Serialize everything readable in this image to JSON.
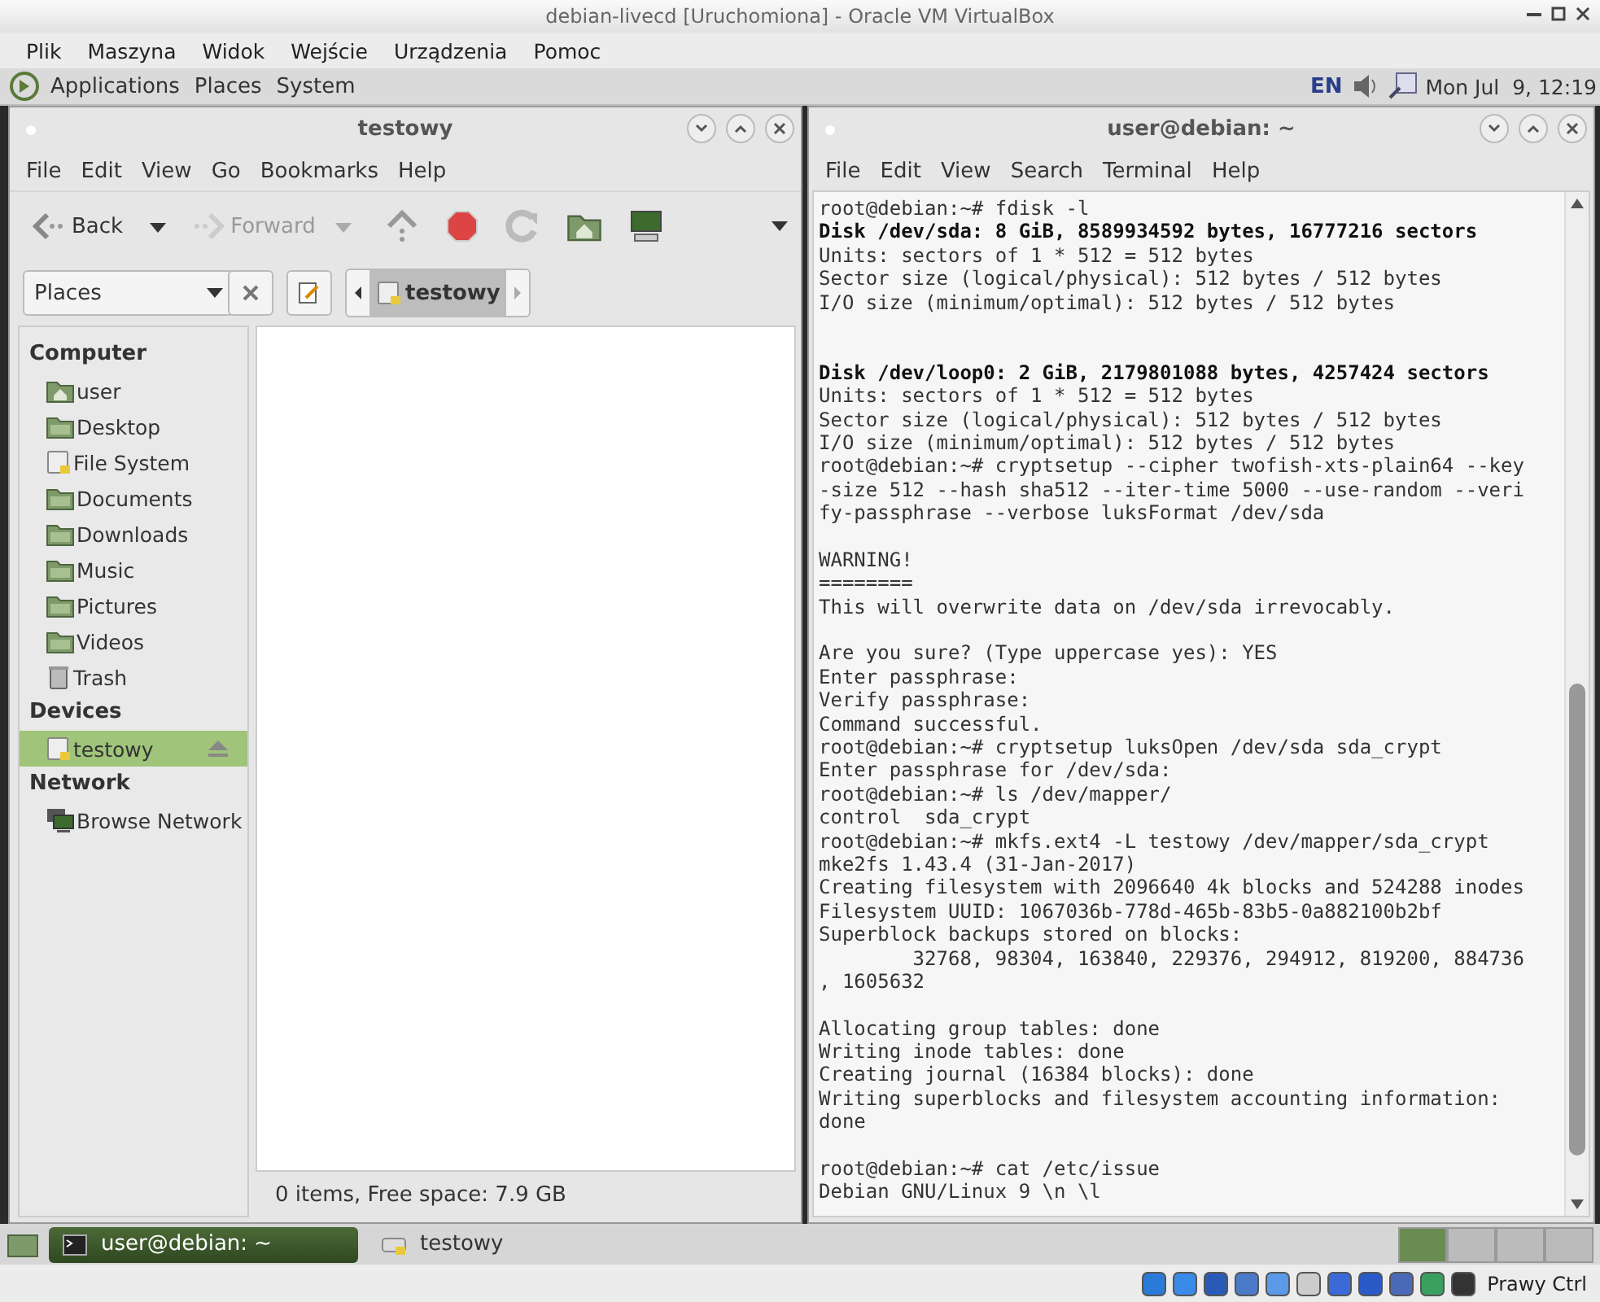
{
  "host_window": {
    "title": "debian-livecd [Uruchomiona] - Oracle VM VirtualBox",
    "menu": [
      "Plik",
      "Maszyna",
      "Widok",
      "Wejście",
      "Urządzenia",
      "Pomoc"
    ]
  },
  "top_panel": {
    "menu": [
      "Applications",
      "Places",
      "System"
    ],
    "keyboard_layout": "EN",
    "clock": "Mon Jul  9, 12:19"
  },
  "file_manager": {
    "title": "testowy",
    "menu": [
      "File",
      "Edit",
      "View",
      "Go",
      "Bookmarks",
      "Help"
    ],
    "toolbar": [
      {
        "kind": "back",
        "label": "Back",
        "disabled": false
      },
      {
        "kind": "forward",
        "label": "Forward",
        "disabled": true
      },
      {
        "kind": "up"
      },
      {
        "kind": "stop"
      },
      {
        "kind": "reload"
      },
      {
        "kind": "home"
      },
      {
        "kind": "computer"
      }
    ],
    "side_pane_selector": "Places",
    "path": "testowy",
    "sidebar": [
      {
        "heading": "Computer",
        "items": [
          {
            "label": "user",
            "kind": "home",
            "selected": false
          },
          {
            "label": "Desktop",
            "kind": "folder",
            "selected": false
          },
          {
            "label": "File System",
            "kind": "drive",
            "selected": false
          },
          {
            "label": "Documents",
            "kind": "folder",
            "selected": false
          },
          {
            "label": "Downloads",
            "kind": "folder",
            "selected": false
          },
          {
            "label": "Music",
            "kind": "folder",
            "selected": false
          },
          {
            "label": "Pictures",
            "kind": "folder",
            "selected": false
          },
          {
            "label": "Videos",
            "kind": "folder",
            "selected": false
          },
          {
            "label": "Trash",
            "kind": "trash",
            "selected": false
          }
        ]
      },
      {
        "heading": "Devices",
        "items": [
          {
            "label": "testowy",
            "kind": "drive",
            "selected": true,
            "ejectable": true
          }
        ]
      },
      {
        "heading": "Network",
        "items": [
          {
            "label": "Browse Network",
            "kind": "network",
            "selected": false
          }
        ]
      }
    ],
    "status": "0 items, Free space: 7.9 GB"
  },
  "terminal": {
    "title": "user@debian: ~",
    "menu": [
      "File",
      "Edit",
      "View",
      "Search",
      "Terminal",
      "Help"
    ],
    "lines": [
      {
        "kind": "text",
        "text": "root@debian:~# fdisk -l",
        "bold": false
      },
      {
        "kind": "text",
        "text": "Disk /dev/sda: 8 GiB, 8589934592 bytes, 16777216 sectors",
        "bold": true
      },
      {
        "kind": "text",
        "text": "Units: sectors of 1 * 512 = 512 bytes",
        "bold": false
      },
      {
        "kind": "text",
        "text": "Sector size (logical/physical): 512 bytes / 512 bytes",
        "bold": false
      },
      {
        "kind": "text",
        "text": "I/O size (minimum/optimal): 512 bytes / 512 bytes",
        "bold": false
      },
      {
        "kind": "blank"
      },
      {
        "kind": "blank"
      },
      {
        "kind": "text",
        "text": "Disk /dev/loop0: 2 GiB, 2179801088 bytes, 4257424 sectors",
        "bold": true
      },
      {
        "kind": "text",
        "text": "Units: sectors of 1 * 512 = 512 bytes",
        "bold": false
      },
      {
        "kind": "text",
        "text": "Sector size (logical/physical): 512 bytes / 512 bytes",
        "bold": false
      },
      {
        "kind": "text",
        "text": "I/O size (minimum/optimal): 512 bytes / 512 bytes",
        "bold": false
      },
      {
        "kind": "text",
        "text": "root@debian:~# cryptsetup --cipher twofish-xts-plain64 --key",
        "bold": false
      },
      {
        "kind": "text",
        "text": "-size 512 --hash sha512 --iter-time 5000 --use-random --veri",
        "bold": false
      },
      {
        "kind": "text",
        "text": "fy-passphrase --verbose luksFormat /dev/sda",
        "bold": false
      },
      {
        "kind": "blank"
      },
      {
        "kind": "text",
        "text": "WARNING!",
        "bold": false
      },
      {
        "kind": "text",
        "text": "========",
        "bold": false
      },
      {
        "kind": "text",
        "text": "This will overwrite data on /dev/sda irrevocably.",
        "bold": false
      },
      {
        "kind": "blank"
      },
      {
        "kind": "text",
        "text": "Are you sure? (Type uppercase yes): YES",
        "bold": false
      },
      {
        "kind": "text",
        "text": "Enter passphrase:",
        "bold": false
      },
      {
        "kind": "text",
        "text": "Verify passphrase:",
        "bold": false
      },
      {
        "kind": "text",
        "text": "Command successful.",
        "bold": false
      },
      {
        "kind": "text",
        "text": "root@debian:~# cryptsetup luksOpen /dev/sda sda_crypt",
        "bold": false
      },
      {
        "kind": "text",
        "text": "Enter passphrase for /dev/sda:",
        "bold": false
      },
      {
        "kind": "text",
        "text": "root@debian:~# ls /dev/mapper/",
        "bold": false
      },
      {
        "kind": "text",
        "text": "control  sda_crypt",
        "bold": false
      },
      {
        "kind": "text",
        "text": "root@debian:~# mkfs.ext4 -L testowy /dev/mapper/sda_crypt",
        "bold": false
      },
      {
        "kind": "text",
        "text": "mke2fs 1.43.4 (31-Jan-2017)",
        "bold": false
      },
      {
        "kind": "text",
        "text": "Creating filesystem with 2096640 4k blocks and 524288 inodes",
        "bold": false
      },
      {
        "kind": "text",
        "text": "Filesystem UUID: 1067036b-778d-465b-83b5-0a882100b2bf",
        "bold": false
      },
      {
        "kind": "text",
        "text": "Superblock backups stored on blocks:",
        "bold": false
      },
      {
        "kind": "text",
        "text": "        32768, 98304, 163840, 229376, 294912, 819200, 884736",
        "bold": false
      },
      {
        "kind": "text",
        "text": ", 1605632",
        "bold": false
      },
      {
        "kind": "blank"
      },
      {
        "kind": "text",
        "text": "Allocating group tables: done",
        "bold": false
      },
      {
        "kind": "text",
        "text": "Writing inode tables: done",
        "bold": false
      },
      {
        "kind": "text",
        "text": "Creating journal (16384 blocks): done",
        "bold": false
      },
      {
        "kind": "text",
        "text": "Writing superblocks and filesystem accounting information:",
        "bold": false
      },
      {
        "kind": "text",
        "text": "done",
        "bold": false
      },
      {
        "kind": "blank"
      },
      {
        "kind": "text",
        "text": "root@debian:~# cat /etc/issue",
        "bold": false
      },
      {
        "kind": "text",
        "text": "Debian GNU/Linux 9 \\n \\l",
        "bold": false
      }
    ]
  },
  "taskbar": [
    {
      "kind": "terminal",
      "label": "user@debian: ~",
      "selected": true
    },
    {
      "kind": "drive",
      "label": "testowy",
      "selected": false
    }
  ],
  "host_status": {
    "host_key": "Prawy Ctrl"
  }
}
